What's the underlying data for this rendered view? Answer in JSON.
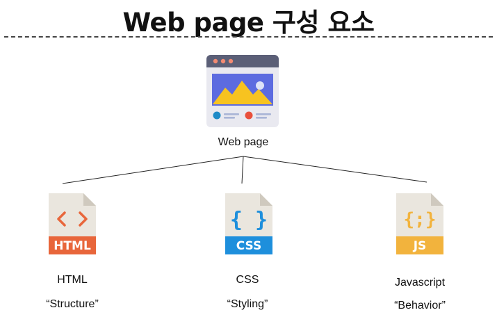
{
  "title": "Web page 구성 요소",
  "root": {
    "label": "Web page",
    "icon": "web-page-icon"
  },
  "children": [
    {
      "id": "html",
      "icon_text": "HTML",
      "label": "HTML",
      "role": "“Structure”",
      "color": "#E8663B",
      "icon": "html-file-icon"
    },
    {
      "id": "css",
      "icon_text": "CSS",
      "label": "CSS",
      "role": "“Styling”",
      "color": "#1E8FDC",
      "icon": "css-file-icon"
    },
    {
      "id": "js",
      "icon_text": "JS",
      "label": "Javascript",
      "role": "“Behavior”",
      "color": "#F2B33D",
      "icon": "js-file-icon"
    }
  ]
}
